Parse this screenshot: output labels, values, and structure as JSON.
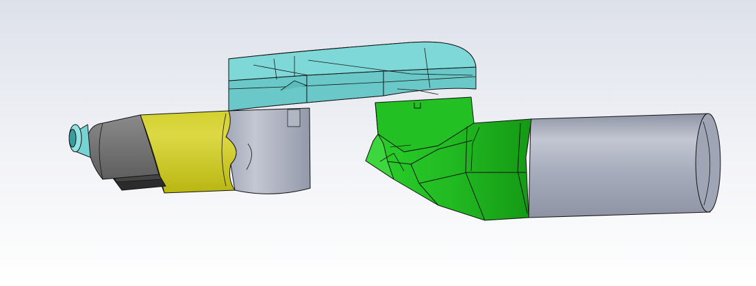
{
  "viewport": {
    "background_top": "#dde1ea",
    "background_bottom": "#ffffff"
  },
  "colors": {
    "outline": "#111111",
    "cyan_light": "#77d3d2",
    "cyan_mid": "#5cbcbc",
    "cyan_dark": "#3a9c9d",
    "cyan_bright": "#8fe2e2",
    "yellow": "#c7c41a",
    "yellow_light": "#dcd945",
    "green": "#23c023",
    "green_light": "#3ed63e",
    "green_dark": "#159915",
    "grey": "#a8adbd",
    "grey_light": "#c3c7d3",
    "grey_dark": "#8e93a4",
    "dark_grey": "#6f6f6f",
    "dark_grey_light": "#8a8a8a",
    "black_part": "#2b2b2b"
  }
}
